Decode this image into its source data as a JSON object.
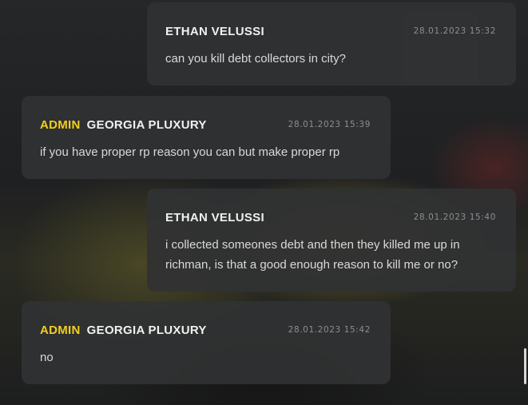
{
  "messages": [
    {
      "role_tag": "",
      "author": "ETHAN VELUSSI",
      "timestamp": "28.01.2023 15:32",
      "text": "can you kill debt collectors in city?"
    },
    {
      "role_tag": "ADMIN",
      "author": "GEORGIA PLUXURY",
      "timestamp": "28.01.2023 15:39",
      "text": "if you have proper rp reason you can but make proper rp"
    },
    {
      "role_tag": "",
      "author": "ETHAN VELUSSI",
      "timestamp": "28.01.2023 15:40",
      "text": "i collected someones debt and then they killed me up in richman, is that a good enough reason to kill me or no?"
    },
    {
      "role_tag": "ADMIN",
      "author": "GEORGIA PLUXURY",
      "timestamp": "28.01.2023 15:42",
      "text": "no"
    }
  ],
  "colors": {
    "admin_tag": "#f3cf1d",
    "bubble_bg": "#303133",
    "timestamp": "#8d8e90"
  }
}
